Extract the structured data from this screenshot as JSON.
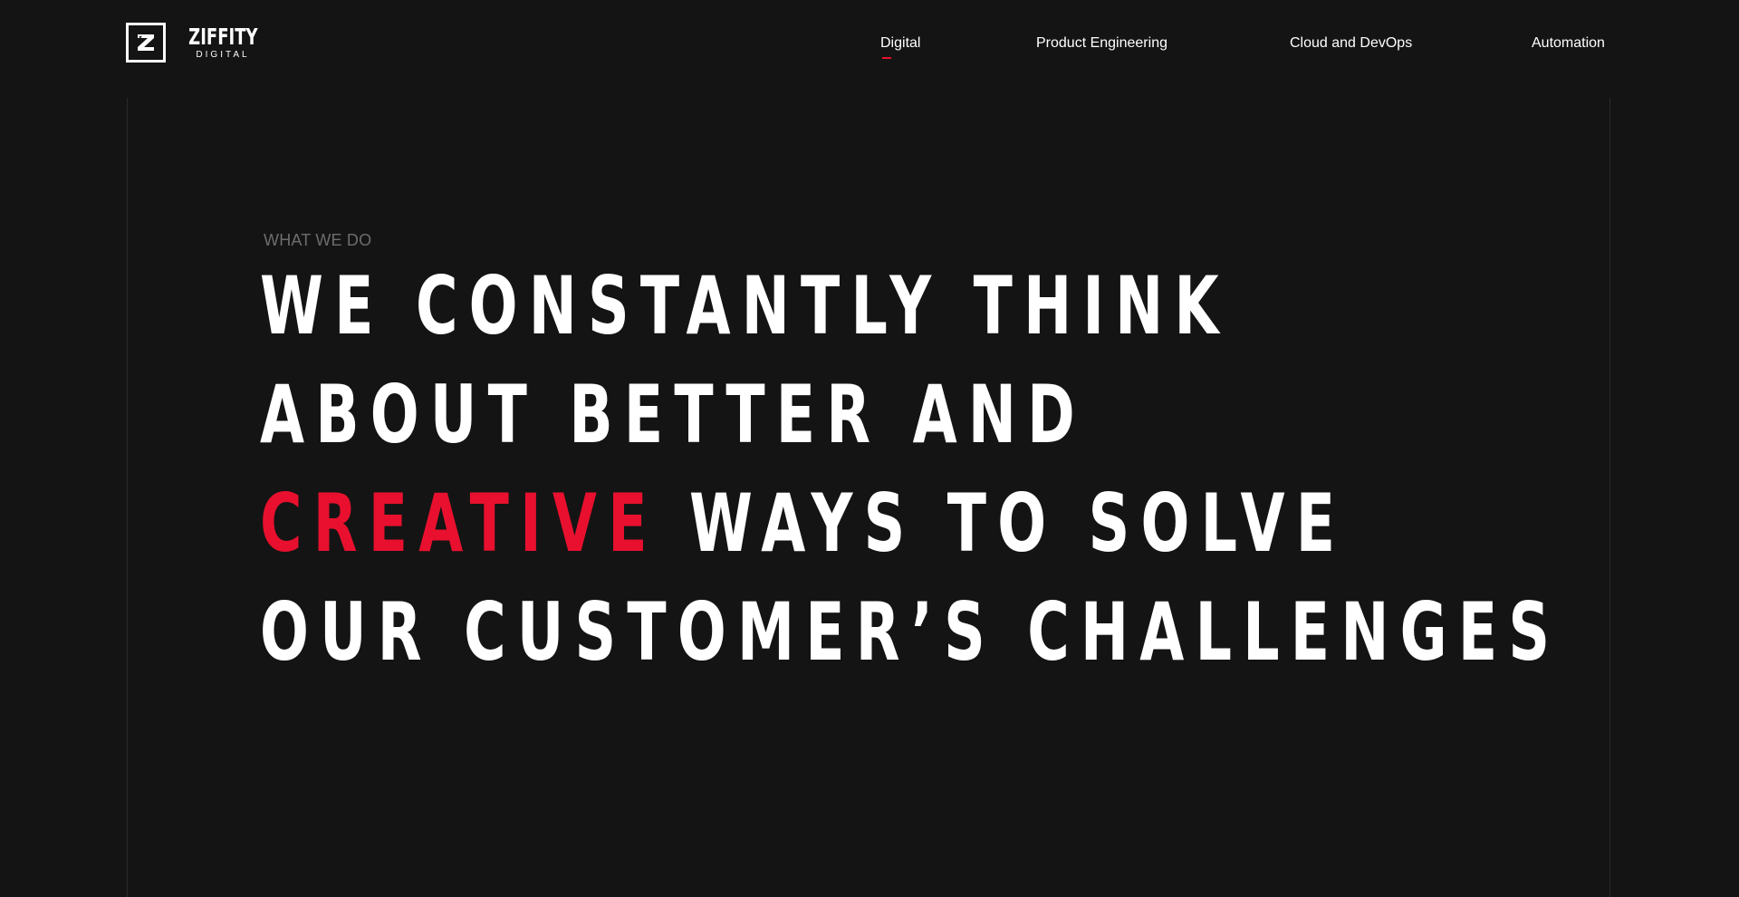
{
  "brand": {
    "name": "ZIFFITY",
    "subtitle": "DIGITAL",
    "accent_color": "#e8102e",
    "background_color": "#141414"
  },
  "nav": {
    "items": [
      {
        "label": "Digital",
        "active": true
      },
      {
        "label": "Product Engineering",
        "active": false
      },
      {
        "label": "Cloud and DevOps",
        "active": false
      },
      {
        "label": "Automation",
        "active": false
      }
    ]
  },
  "hero": {
    "eyebrow": "WHAT WE DO",
    "line1": "WE CONSTANTLY THINK",
    "line2": "ABOUT BETTER AND",
    "line3_accent": "CREATIVE",
    "line3_rest": " WAYS TO SOLVE",
    "line4": "OUR CUSTOMER’S CHALLENGES"
  }
}
